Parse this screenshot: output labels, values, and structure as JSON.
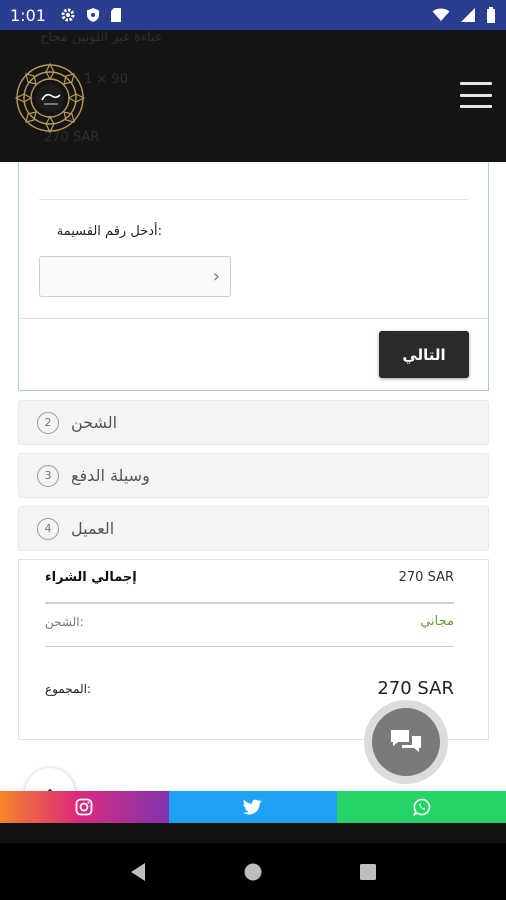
{
  "status_bar": {
    "time": "1:01"
  },
  "header": {
    "ghost_title": "عباءة غير اللونين مجاح",
    "ghost_qty": "1  ×  90",
    "ghost_price": "270 SAR"
  },
  "checkout": {
    "installment_label": ":أدخل رقم القسيمة",
    "installment_placeholder": "",
    "next_button": "التالي",
    "steps": [
      {
        "number": "2",
        "label": "الشحن"
      },
      {
        "number": "3",
        "label": "وسيلة الدفع"
      },
      {
        "number": "4",
        "label": "العميل"
      }
    ]
  },
  "summary": {
    "purchase_total_label": "إجمالي الشراء",
    "purchase_total_value": "270 SAR",
    "shipping_label": ":الشحن",
    "shipping_value": "مجاني",
    "total_label": ":المجموع",
    "total_value": "270 SAR"
  },
  "colors": {
    "status_bar": "#2b3d8f",
    "header_bg": "#141414",
    "next_button_bg": "#2a2a2a",
    "shipping_free": "#6a9a3a",
    "twitter": "#1da1f2",
    "whatsapp": "#25d366"
  },
  "icons": {
    "status": [
      "settings-icon",
      "shield-icon",
      "sd-card-icon",
      "wifi-icon",
      "signal-icon",
      "battery-icon"
    ],
    "social": [
      "instagram-icon",
      "twitter-icon",
      "whatsapp-icon"
    ],
    "nav": [
      "back-icon",
      "home-icon",
      "recents-icon"
    ]
  }
}
